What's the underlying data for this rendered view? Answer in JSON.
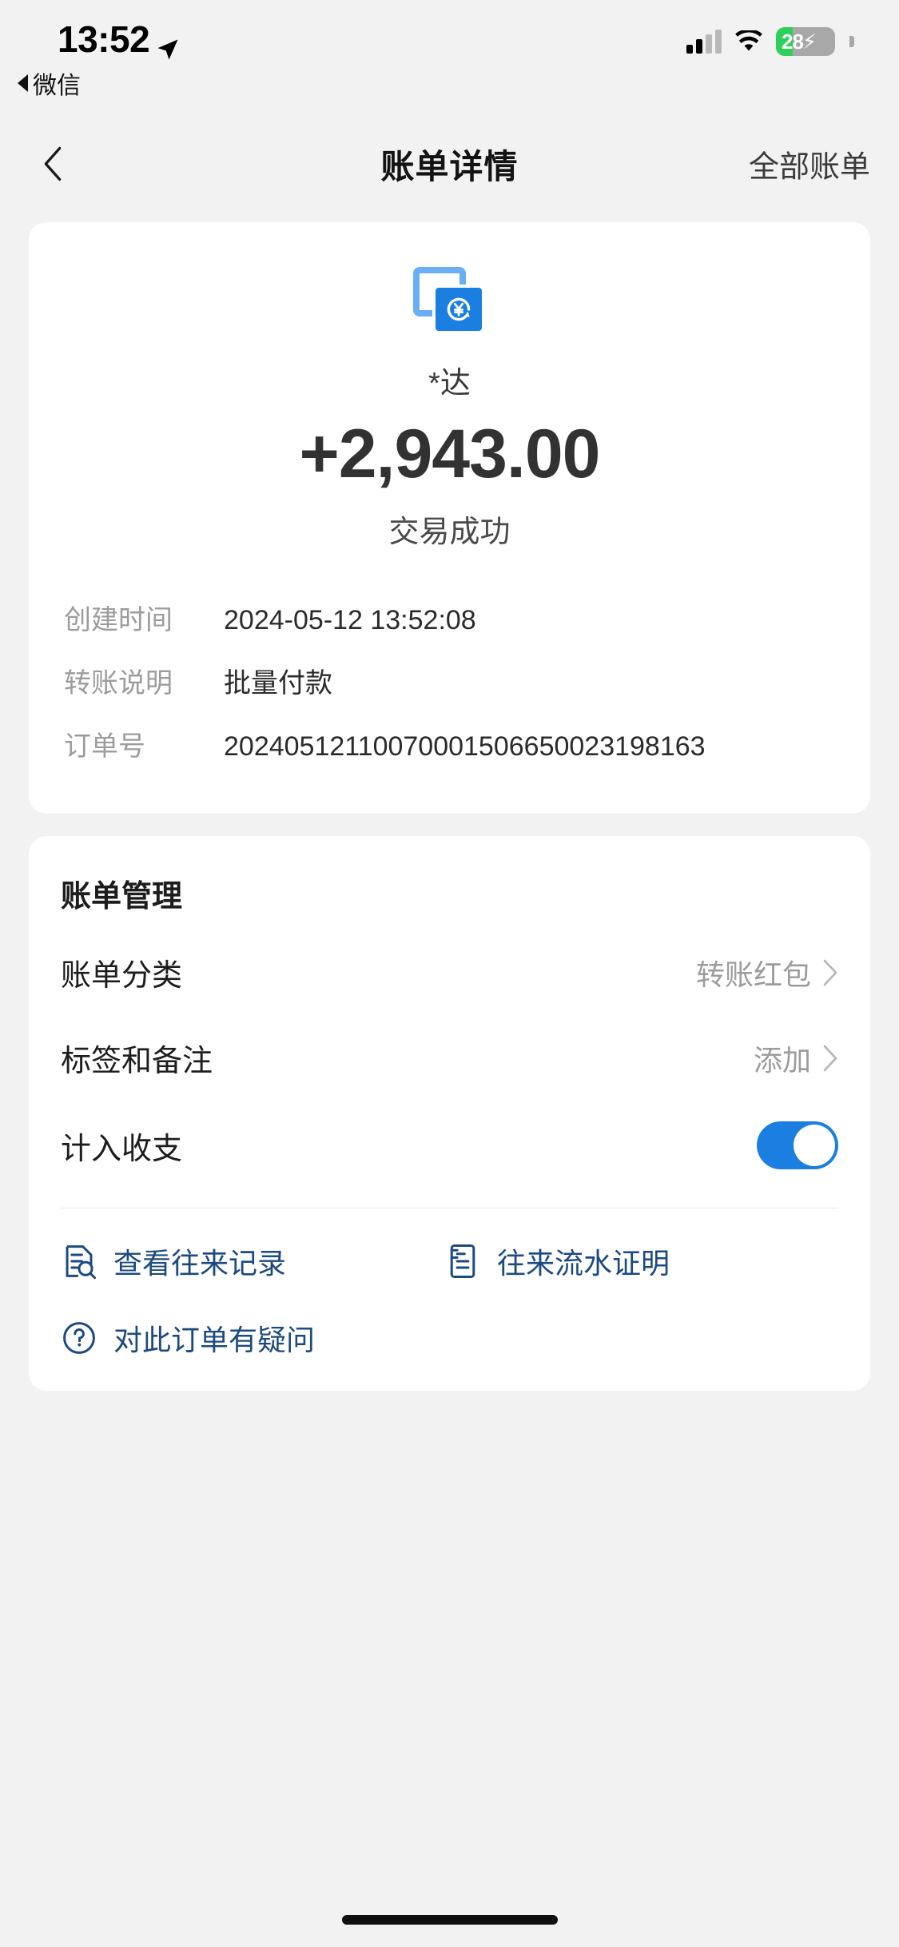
{
  "status_bar": {
    "time": "13:52",
    "back_app_label": "微信",
    "battery_level": "28",
    "battery_percent": 28,
    "charging_glyph": "⚡",
    "icons": {
      "location": "location-arrow-icon",
      "signal": "cellular-signal-icon",
      "wifi": "wifi-icon",
      "battery": "battery-icon"
    }
  },
  "nav": {
    "back_icon": "chevron-left-icon",
    "title": "账单详情",
    "right_link": "全部账单"
  },
  "transaction": {
    "icon_name": "transfer-cards-icon",
    "payee": "*达",
    "amount": "+2,943.00",
    "status": "交易成功",
    "details": [
      {
        "label": "创建时间",
        "value": "2024-05-12 13:52:08"
      },
      {
        "label": "转账说明",
        "value": "批量付款"
      },
      {
        "label": "订单号",
        "value": "20240512110070001506650023198163"
      }
    ]
  },
  "management": {
    "title": "账单管理",
    "rows": [
      {
        "label": "账单分类",
        "value": "转账红包",
        "type": "link",
        "icon": "chevron-right-icon"
      },
      {
        "label": "标签和备注",
        "value": "添加",
        "type": "link",
        "icon": "chevron-right-icon"
      },
      {
        "label": "计入收支",
        "value": "",
        "type": "switch",
        "switch_on": true
      }
    ],
    "links": [
      {
        "label": "查看往来记录",
        "icon": "document-search-icon"
      },
      {
        "label": "往来流水证明",
        "icon": "document-list-icon"
      },
      {
        "label": "对此订单有疑问",
        "icon": "question-circle-icon"
      }
    ]
  },
  "colors": {
    "accent_blue": "#1a7fe0",
    "link_navy": "#1c4a80",
    "battery_green": "#2ed158",
    "page_bg": "#f2f2f2"
  }
}
